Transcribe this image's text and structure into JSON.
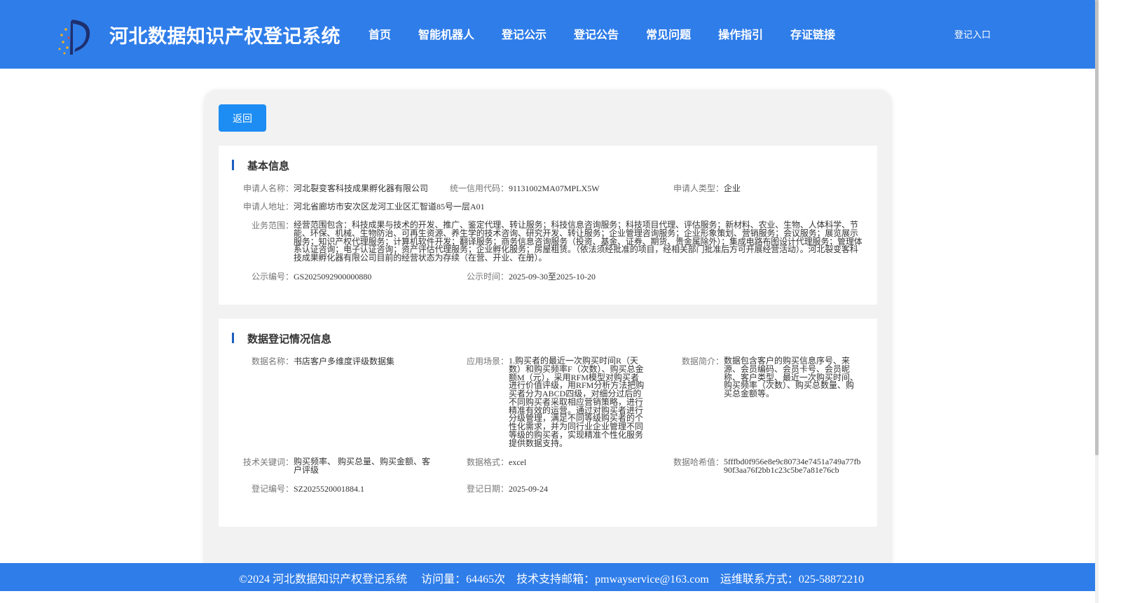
{
  "header": {
    "site_title": "河北数据知识产权登记系统",
    "nav": [
      "首页",
      "智能机器人",
      "登记公示",
      "登记公告",
      "常见问题",
      "操作指引",
      "存证链接"
    ],
    "login_label": "登记入口"
  },
  "back_label": "返回",
  "basic": {
    "title": "基本信息",
    "applicant_name_label": "申请人名称：",
    "applicant_name": "河北裂变客科技成果孵化器有限公司",
    "credit_code_label": "统一信用代码：",
    "credit_code": "91131002MA07MPLX5W",
    "applicant_type_label": "申请人类型：",
    "applicant_type": "企业",
    "address_label": "申请人地址：",
    "address": "河北省廊坊市安次区龙河工业区汇智道85号一层A01",
    "scope_label": "业务范围：",
    "scope": "经营范围包含：科技成果与技术的开发、推广、鉴定代理、转让服务；科技信息咨询服务；科技项目代理、评估服务；新材料、农业、生物、人体科学、节能、环保、机械、生物防治、可再生资源、养生学的技术咨询、研究开发、转让服务；企业管理咨询服务；企业形象策划、营销服务；会议服务；展览展示服务；知识产权代理服务；计算机软件开发；翻译服务；商务信息咨询服务（投资、基金、证券、期货、贵金属除外）；集成电路布图设计代理服务；管理体系认证咨询；电子认证咨询；资产评估代理服务；企业孵化服务；房屋租赁。（依法须经批准的项目，经相关部门批准后方可开展经营活动）。河北裂变客科技成果孵化器有限公司目前的经营状态为存续（在营、开业、在册）。",
    "pub_no_label": "公示编号：",
    "pub_no": "GS2025092900000880",
    "pub_time_label": "公示时间：",
    "pub_time": "2025-09-30至2025-10-20"
  },
  "registration": {
    "title": "数据登记情况信息",
    "data_name_label": "数据名称：",
    "data_name": "书店客户多维度评级数据集",
    "scenario_label": "应用场景：",
    "scenario": "1.购买者的最近一次购买时间R（天数）和购买频率F（次数）、购买总金额M（元），采用RFM模型对购买者进行价值评级，用RFM分析方法把购买者分为ABCD四级，对细分过后的不同购买者采取相应营销策略，进行精准有效的运营。通过对购买者进行分级管理，满足不同等级购买者的个性化需求，并为同行业企业管理不同等级的购买者，实现精准个性化服务提供数据支持。",
    "intro_label": "数据简介：",
    "intro": "数据包含客户的购买信息序号、来源、会员编码、会员卡号、会员昵称、客户类型、最近一次购买时间、购买频率（次数）、购买总数量、购买总金额等。",
    "keywords_label": "技术关键词：",
    "keywords": "购买频率、 购买总量、购买金额、客户评级",
    "format_label": "数据格式：",
    "format": "excel",
    "hash_label": "数据哈希值：",
    "hash": "5fffbd0f956e8e9c80734e7451a749a77fb90f3aa76f2bb1c23c5be7a81e76cb",
    "reg_no_label": "登记编号：",
    "reg_no": "SZ2025520001884.1",
    "reg_date_label": "登记日期：",
    "reg_date": "2025-09-24"
  },
  "footer": {
    "text": "©2024 河北数据知识产权登记系统     访问量：64465次    技术支持邮箱：pmwayservice@163.com    运维联系方式：025-58872210"
  },
  "colors": {
    "header_bg": "#2f7de9",
    "button_bg": "#1d8df3",
    "section_accent": "#1d5fbf"
  }
}
